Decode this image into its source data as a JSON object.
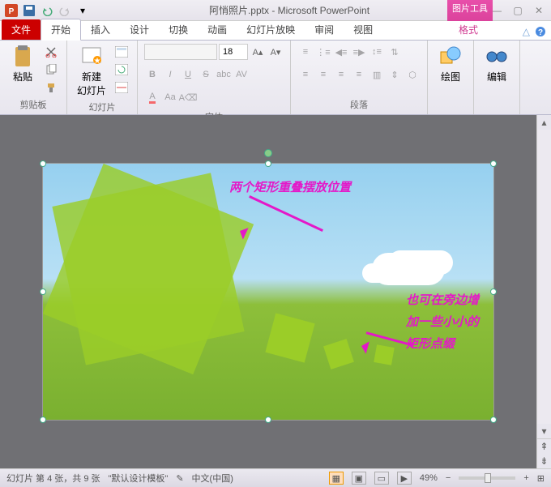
{
  "title": "阿悄照片.pptx - Microsoft PowerPoint",
  "contextual": {
    "title": "图片工具",
    "tab": "格式"
  },
  "tabs": {
    "file": "文件",
    "home": "开始",
    "insert": "插入",
    "design": "设计",
    "transitions": "切换",
    "animations": "动画",
    "slideshow": "幻灯片放映",
    "review": "审阅",
    "view": "视图"
  },
  "groups": {
    "clipboard": {
      "label": "剪贴板",
      "paste": "粘贴"
    },
    "slides": {
      "label": "幻灯片",
      "new_slide": "新建\n幻灯片"
    },
    "font": {
      "label": "字体",
      "size": "18",
      "font_placeholder": ""
    },
    "paragraph": {
      "label": "段落"
    },
    "drawing": {
      "label": "绘图"
    },
    "editing": {
      "label": "编辑"
    }
  },
  "annotations": {
    "top": "两个矩形重叠摆放位置",
    "right": "也可在旁边增加一些小小的矩形点缀"
  },
  "status": {
    "slide_info": "幻灯片 第 4 张，共 9 张",
    "template": "\"默认设计模板\"",
    "language": "中文(中国)",
    "zoom": "49%"
  }
}
